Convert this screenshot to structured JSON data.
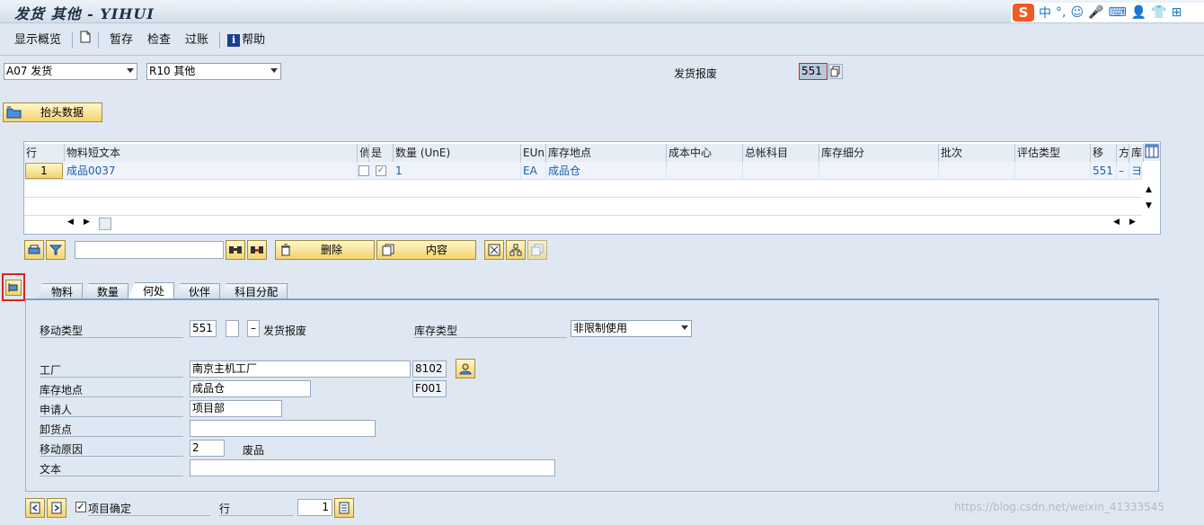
{
  "window": {
    "title": "发货 其他 - YIHUI"
  },
  "ime": {
    "logo": "S",
    "items": [
      "中",
      "°,",
      "☺",
      "🎤",
      "⌨",
      "👤",
      "👕",
      "⊞"
    ]
  },
  "toolbar": {
    "show_overview": "显示概览",
    "hold": "暂存",
    "check": "检查",
    "post": "过账",
    "help": "帮助"
  },
  "header": {
    "transaction": "A07 发货",
    "reference": "R10 其他",
    "mvt_label": "发货报废",
    "mvt_value": "551",
    "header_data_button": "抬头数据"
  },
  "table": {
    "columns": [
      "行",
      "物料短文本",
      "俏",
      "是",
      "数量 (UnE)",
      "EUn",
      "库存地点",
      "成本中心",
      "总帐科目",
      "库存细分",
      "批次",
      "评估类型",
      "移",
      "方",
      "库"
    ],
    "rows": [
      {
        "line": "1",
        "material": "成品0037",
        "qty": "1",
        "unit": "EA",
        "sloc": "成品仓",
        "mvt": "551",
        "dir": "–",
        "stock": "ヨ"
      }
    ]
  },
  "table_toolbar": {
    "delete_button": "删除",
    "content_button": "内容",
    "search_value": ""
  },
  "tabs": [
    "物料",
    "数量",
    "何处",
    "伙伴",
    "科目分配"
  ],
  "active_tab": "何处",
  "detail": {
    "mvt_type_label": "移动类型",
    "mvt_type_value": "551",
    "mvt_plus": "",
    "mvt_minus": "–",
    "mvt_desc": "发货报废",
    "stock_type_label": "库存类型",
    "stock_type_value": "非限制使用",
    "plant_label": "工厂",
    "plant_name": "南京主机工厂",
    "plant_code": "8102",
    "sloc_label": "库存地点",
    "sloc_name": "成品仓",
    "sloc_code": "F001",
    "requester_label": "申请人",
    "requester_value": "项目部",
    "unload_label": "卸货点",
    "unload_value": "",
    "reason_label": "移动原因",
    "reason_value": "2",
    "reason_desc": "废品",
    "text_label": "文本",
    "text_value": ""
  },
  "footer": {
    "item_ok_label": "项目确定",
    "line_label": "行",
    "line_value": "1"
  },
  "watermark": "https://blog.csdn.net/weixin_41333545",
  "colors": {
    "accent": "#1d5fa8",
    "button": "#f3d36d",
    "highlight": "#e02020"
  }
}
